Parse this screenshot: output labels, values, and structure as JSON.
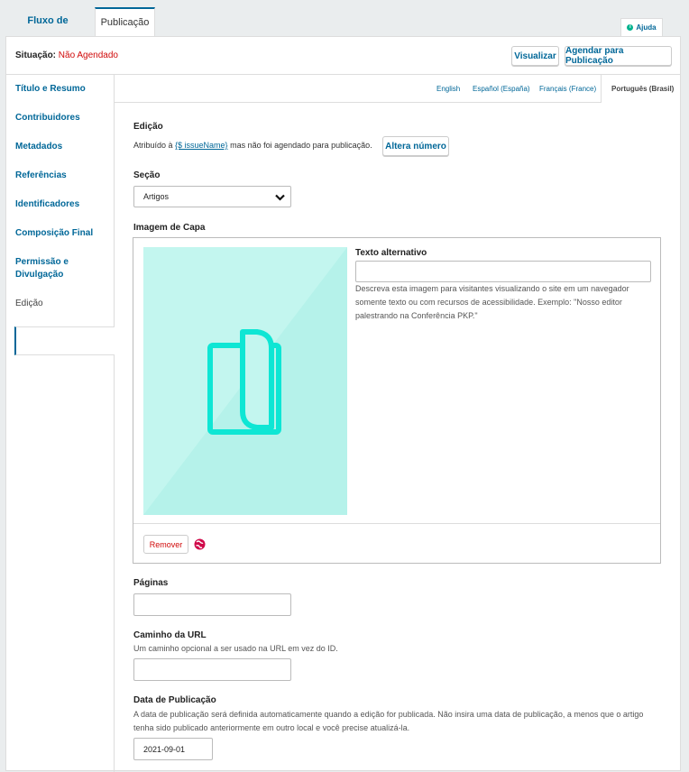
{
  "tabs": {
    "workflow": "Fluxo de Trabalho",
    "publication": "Publicação"
  },
  "help": {
    "label": "Ajuda",
    "icon": "info-icon"
  },
  "status": {
    "label": "Situação:",
    "value": "Não Agendado",
    "value_color": "#d00a0a"
  },
  "actions": {
    "preview": "Visualizar",
    "schedule": "Agendar para Publicação"
  },
  "sidebar": {
    "items": [
      {
        "label": "Título e Resumo"
      },
      {
        "label": "Contribuidores"
      },
      {
        "label": "Metadados"
      },
      {
        "label": "Referências"
      },
      {
        "label": "Identificadores"
      },
      {
        "label": "Composição Final"
      },
      {
        "label": "Permissão e Divulgação"
      },
      {
        "label": "Edição",
        "active": true
      }
    ]
  },
  "languages": {
    "items": [
      "English",
      "Español (España)",
      "Français (France)",
      "Português (Brasil)"
    ],
    "active": "Português (Brasil)"
  },
  "issue": {
    "label": "Edição",
    "assigned_prefix": "Atribuído à ",
    "issue_link": "{$ issueName}",
    "assigned_suffix": " mas não foi agendado para publicação.",
    "change_button": "Altera número"
  },
  "section": {
    "label": "Seção",
    "value": "Artigos"
  },
  "cover": {
    "label": "Imagem de Capa",
    "alt_label": "Texto alternativo",
    "alt_value": "",
    "alt_help": "Descreva esta imagem para visitantes visualizando o site em um navegador somente texto ou com recursos de acessibilidade. Exemplo: \"Nosso editor palestrando na Conferência PKP.\"",
    "remove_button": "Remover",
    "image_bg": "#c3f6ef",
    "icon_color": "#0ee6d4"
  },
  "pages": {
    "label": "Páginas",
    "value": ""
  },
  "url_path": {
    "label": "Caminho da URL",
    "help": "Um caminho opcional a ser usado na URL em vez do ID.",
    "value": ""
  },
  "pub_date": {
    "label": "Data de Publicação",
    "help": "A data de publicação será definida automaticamente quando a edição for publicada. Não insira uma data de publicação, a menos que o artigo tenha sido publicado anteriormente em outro local e você precise atualizá-la.",
    "value": "2021-09-01"
  },
  "colors": {
    "accent": "#006798",
    "danger": "#d00a0a",
    "success": "#00b28d"
  }
}
